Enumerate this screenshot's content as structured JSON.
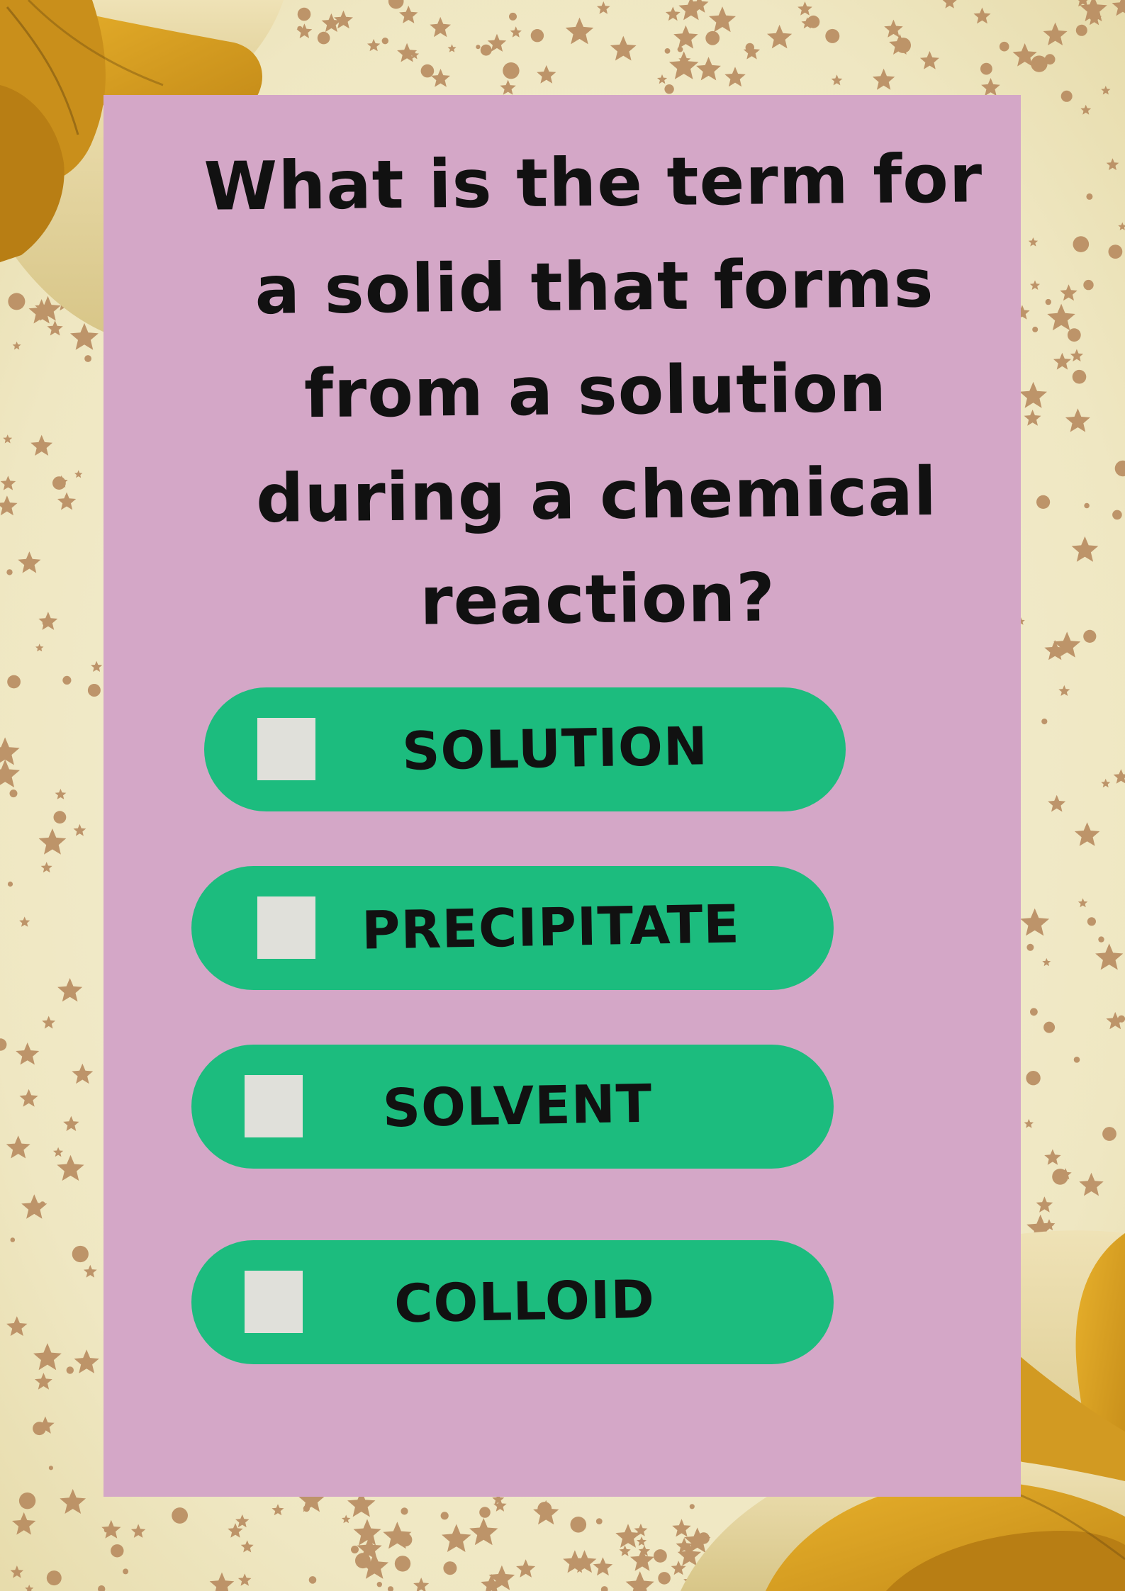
{
  "question": {
    "lines": [
      "What is the term for",
      "a solid that forms",
      "from a solution",
      "during a chemical",
      "reaction?"
    ]
  },
  "options": [
    {
      "label": "SOLUTION",
      "checked": false
    },
    {
      "label": "PRECIPITATE",
      "checked": false
    },
    {
      "label": "SOLVENT",
      "checked": false
    },
    {
      "label": "COLLOID",
      "checked": false
    }
  ],
  "colors": {
    "card": "#d4a7c7",
    "option": "#1cbc7e",
    "checkbox": "#e0e0da",
    "paper": "#f2ecce",
    "petal": "#d9a325",
    "star": "#b5865a",
    "text": "#111111"
  },
  "decorations": {
    "background": "parchment-texture",
    "corner_art": "yellow-flower-illustration",
    "sprinkles": "star-confetti"
  }
}
